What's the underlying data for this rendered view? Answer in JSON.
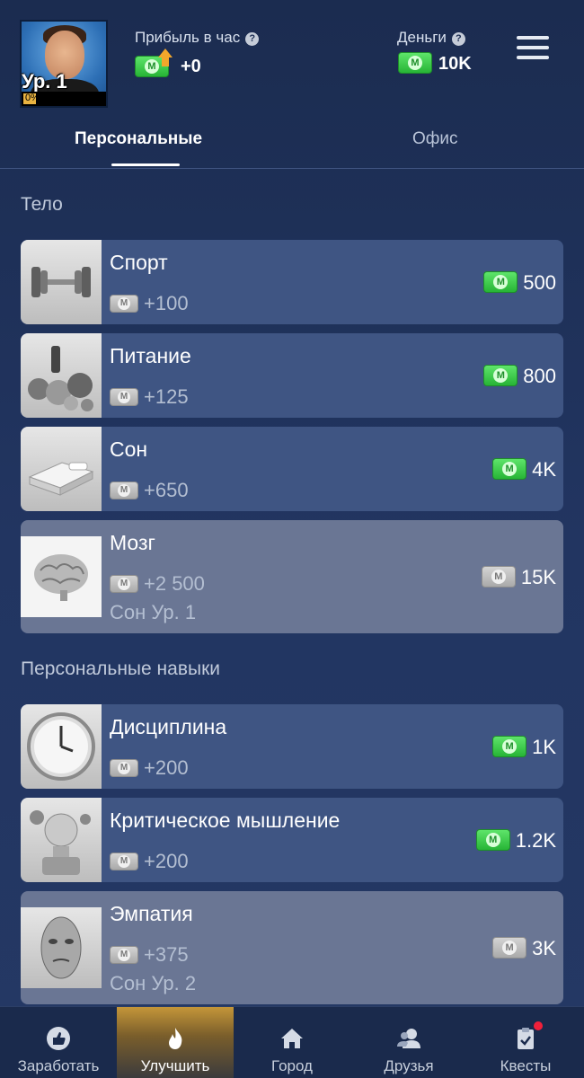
{
  "header": {
    "level": "Ур. 1",
    "profit_label": "Прибыль в час",
    "profit_value": "+0",
    "money_label": "Деньги",
    "money_value": "10K",
    "help_glyph": "?"
  },
  "tabs": [
    {
      "label": "Персональные",
      "active": true
    },
    {
      "label": "Офис",
      "active": false
    }
  ],
  "sections": [
    {
      "title": "Тело",
      "items": [
        {
          "title": "Спорт",
          "profit": "+100",
          "price": "500",
          "affordable": true,
          "icon": "dumbbell"
        },
        {
          "title": "Питание",
          "profit": "+125",
          "price": "800",
          "affordable": true,
          "icon": "food"
        },
        {
          "title": "Сон",
          "profit": "+650",
          "price": "4K",
          "affordable": true,
          "icon": "bed"
        },
        {
          "title": "Мозг",
          "profit": "+2 500",
          "price": "15K",
          "affordable": false,
          "requirement": "Сон Ур. 1",
          "icon": "brain"
        }
      ]
    },
    {
      "title": "Персональные навыки",
      "items": [
        {
          "title": "Дисциплина",
          "profit": "+200",
          "price": "1K",
          "affordable": true,
          "icon": "clock"
        },
        {
          "title": "Критическое мышление",
          "profit": "+200",
          "price": "1.2K",
          "affordable": true,
          "icon": "thinker"
        },
        {
          "title": "Эмпатия",
          "profit": "+375",
          "price": "3K",
          "affordable": false,
          "requirement": "Сон Ур. 2",
          "icon": "mask"
        }
      ]
    }
  ],
  "nav": [
    {
      "label": "Заработать",
      "icon": "thumbs-up-icon",
      "active": false
    },
    {
      "label": "Улучшить",
      "icon": "fire-icon",
      "active": true
    },
    {
      "label": "Город",
      "icon": "home-icon",
      "active": false
    },
    {
      "label": "Друзья",
      "icon": "friends-icon",
      "active": false
    },
    {
      "label": "Квесты",
      "icon": "clipboard-check-icon",
      "active": false,
      "notification": true
    }
  ],
  "colors": {
    "background": "#223561",
    "card": "#3f5583",
    "card_locked": "#6a7694",
    "money_green": "#27b536",
    "accent_gold": "#c49639",
    "notification": "#f0203a"
  }
}
